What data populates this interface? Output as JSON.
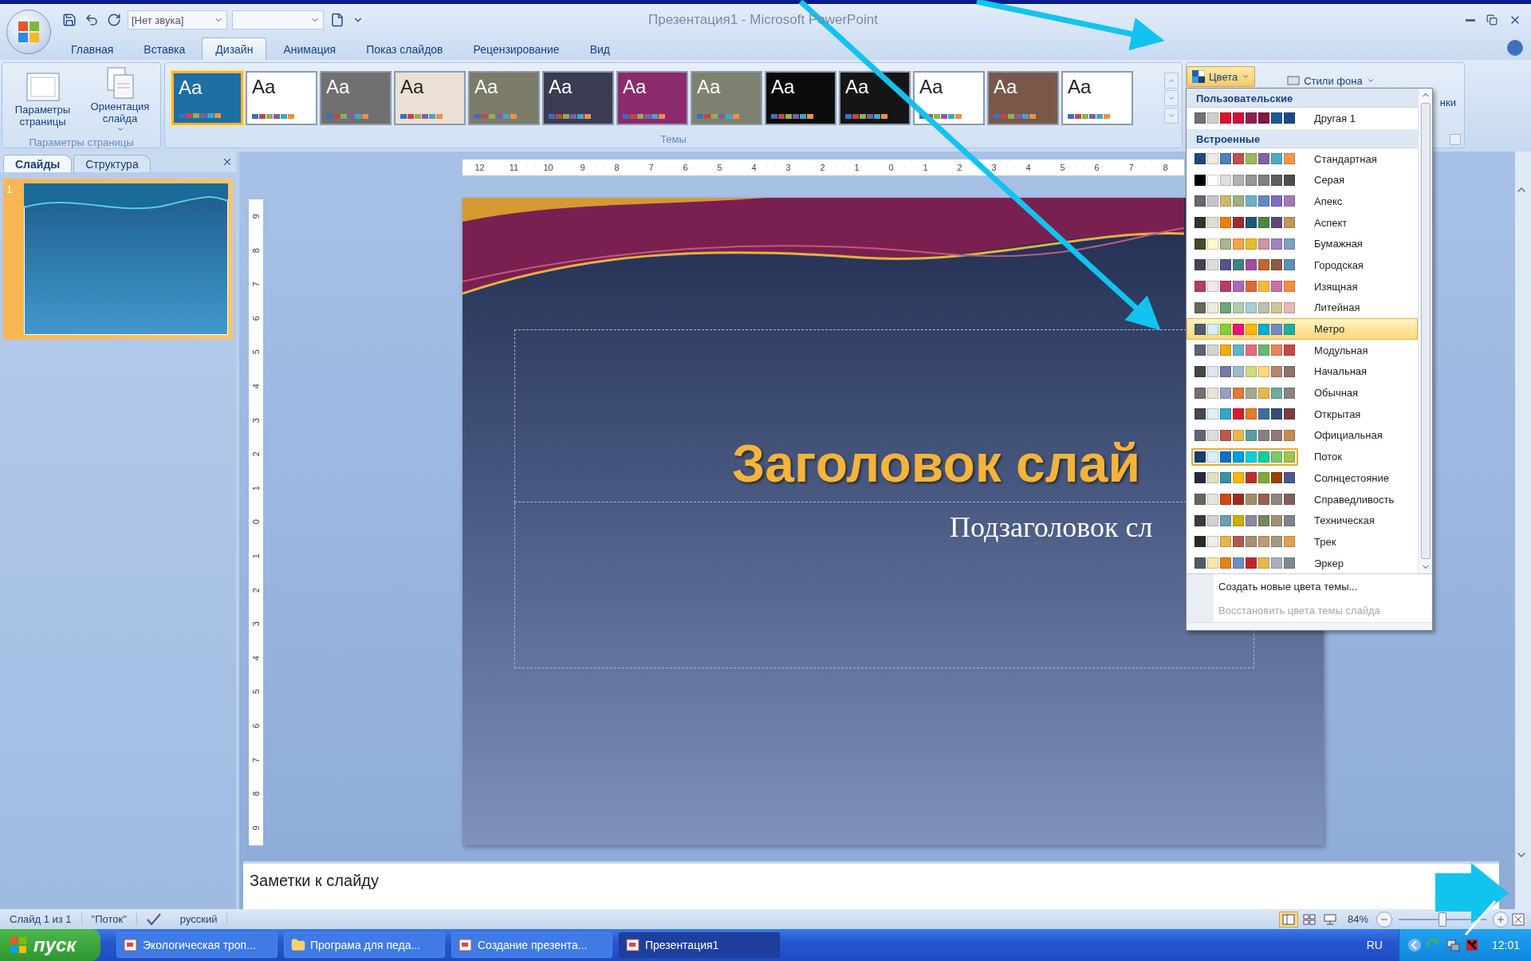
{
  "window": {
    "title": "Презентация1 - Microsoft PowerPoint"
  },
  "quick_access": {
    "sound": "[Нет звука]"
  },
  "tabs": [
    {
      "label": "Главная",
      "selected": false
    },
    {
      "label": "Вставка",
      "selected": false
    },
    {
      "label": "Дизайн",
      "selected": true
    },
    {
      "label": "Анимация",
      "selected": false
    },
    {
      "label": "Показ слайдов",
      "selected": false
    },
    {
      "label": "Рецензирование",
      "selected": false
    },
    {
      "label": "Вид",
      "selected": false
    }
  ],
  "ribbon": {
    "page_group": {
      "title": "Параметры страницы",
      "buttons": [
        {
          "label": "Параметры страницы",
          "kind": "page",
          "dropdown": false
        },
        {
          "label": "Ориентация слайда",
          "kind": "orientation",
          "dropdown": true
        }
      ]
    },
    "themes": {
      "title": "Темы",
      "items": [
        {
          "label": "Aa",
          "color": "#1d6fa5",
          "selected": true
        },
        {
          "label": "Aa",
          "color": "#ffffff",
          "selected": false
        },
        {
          "label": "Aa",
          "color": "#707070",
          "selected": false
        },
        {
          "label": "Aa",
          "color": "#ece0d4",
          "selected": false
        },
        {
          "label": "Aa",
          "color": "#7b7b68",
          "selected": false
        },
        {
          "label": "Aa",
          "color": "#3b3b52",
          "selected": false
        },
        {
          "label": "Aa",
          "color": "#8c2a6e",
          "selected": false
        },
        {
          "label": "Aa",
          "color": "#7e8170",
          "selected": false
        },
        {
          "label": "Aa",
          "color": "#0b0b0b",
          "selected": false
        },
        {
          "label": "Aa",
          "color": "#151515",
          "selected": false
        },
        {
          "label": "Aa",
          "color": "#ffffff",
          "selected": false
        },
        {
          "label": "Aa",
          "color": "#7a5848",
          "selected": false
        },
        {
          "label": "Aa",
          "color": "#ffffff",
          "selected": false
        }
      ]
    },
    "colors_button": {
      "label": "Цвета",
      "pressed": true
    },
    "background_styles": {
      "label": "Стили фона"
    },
    "cut_label": "нки"
  },
  "slides_pane": {
    "tabs": [
      {
        "label": "Слайды",
        "selected": true
      },
      {
        "label": "Структура",
        "selected": false
      }
    ],
    "slides": [
      {
        "number": "1",
        "selected": true
      }
    ]
  },
  "rulers": {
    "horizontal": [
      "12",
      "11",
      "10",
      "9",
      "8",
      "7",
      "6",
      "5",
      "4",
      "3",
      "2",
      "1",
      "0",
      "1",
      "2",
      "3",
      "4",
      "5",
      "6",
      "7",
      "8"
    ],
    "vertical": [
      "9",
      "8",
      "7",
      "6",
      "5",
      "4",
      "3",
      "2",
      "1",
      "0",
      "1",
      "2",
      "3",
      "4",
      "5",
      "6",
      "7",
      "8",
      "9"
    ]
  },
  "slide": {
    "title": "Заголовок слай",
    "subtitle": "Подзаголовок сл"
  },
  "notes": {
    "prompt": "Заметки к слайду"
  },
  "colors_menu": {
    "sections": [
      {
        "title": "Пользовательские",
        "schemes": [
          {
            "name": "Другая 1",
            "swatches": [
              {
                "color": "#707070"
              },
              {
                "color": "#d0d0d0"
              },
              {
                "color": "#e01030"
              },
              {
                "color": "#d01040"
              },
              {
                "color": "#902050"
              },
              {
                "color": "#801848"
              },
              {
                "color": "#1a5a9a"
              },
              {
                "color": "#1a4a8a"
              }
            ],
            "highlighted": false,
            "selected": false
          }
        ]
      },
      {
        "title": "Встроенные",
        "schemes": [
          {
            "name": "Стандартная",
            "swatches": [
              {
                "color": "#1f497d"
              },
              {
                "color": "#eeece1"
              },
              {
                "color": "#4f81bd"
              },
              {
                "color": "#c0504d"
              },
              {
                "color": "#9bbb59"
              },
              {
                "color": "#8064a2"
              },
              {
                "color": "#4bacc6"
              },
              {
                "color": "#f79646"
              }
            ],
            "highlighted": false,
            "selected": false
          },
          {
            "name": "Серая",
            "swatches": [
              {
                "color": "#000000"
              },
              {
                "color": "#ffffff"
              },
              {
                "color": "#dddddd"
              },
              {
                "color": "#b2b2b2"
              },
              {
                "color": "#969696"
              },
              {
                "color": "#808080"
              },
              {
                "color": "#5f5f5f"
              },
              {
                "color": "#4d4d4d"
              }
            ],
            "highlighted": false,
            "selected": false
          },
          {
            "name": "Апекс",
            "swatches": [
              {
                "color": "#69676d"
              },
              {
                "color": "#c9c2d1"
              },
              {
                "color": "#ceb966"
              },
              {
                "color": "#9cb084"
              },
              {
                "color": "#6bb1c9"
              },
              {
                "color": "#6585cf"
              },
              {
                "color": "#7e6bc9"
              },
              {
                "color": "#a379bb"
              }
            ],
            "highlighted": false,
            "selected": false
          },
          {
            "name": "Аспект",
            "swatches": [
              {
                "color": "#323232"
              },
              {
                "color": "#e3ded1"
              },
              {
                "color": "#f07f09"
              },
              {
                "color": "#9f2936"
              },
              {
                "color": "#1b587c"
              },
              {
                "color": "#4e8542"
              },
              {
                "color": "#604878"
              },
              {
                "color": "#c19859"
              }
            ],
            "highlighted": false,
            "selected": false
          },
          {
            "name": "Бумажная",
            "swatches": [
              {
                "color": "#444d26"
              },
              {
                "color": "#fefac9"
              },
              {
                "color": "#a5b592"
              },
              {
                "color": "#f3a447"
              },
              {
                "color": "#e7bc29"
              },
              {
                "color": "#d092a7"
              },
              {
                "color": "#9c85c0"
              },
              {
                "color": "#809ec2"
              }
            ],
            "highlighted": false,
            "selected": false
          },
          {
            "name": "Городская",
            "swatches": [
              {
                "color": "#424456"
              },
              {
                "color": "#dedede"
              },
              {
                "color": "#53548a"
              },
              {
                "color": "#438086"
              },
              {
                "color": "#a04da3"
              },
              {
                "color": "#c4652d"
              },
              {
                "color": "#8b5d3d"
              },
              {
                "color": "#5c92b5"
              }
            ],
            "highlighted": false,
            "selected": false
          },
          {
            "name": "Изящная",
            "swatches": [
              {
                "color": "#b13f5a"
              },
              {
                "color": "#f4e7ed"
              },
              {
                "color": "#b83d68"
              },
              {
                "color": "#ac66bb"
              },
              {
                "color": "#de6c36"
              },
              {
                "color": "#f9b639"
              },
              {
                "color": "#cf6da4"
              },
              {
                "color": "#fa8d3d"
              }
            ],
            "highlighted": false,
            "selected": false
          },
          {
            "name": "Литейная",
            "swatches": [
              {
                "color": "#676a55"
              },
              {
                "color": "#eaebde"
              },
              {
                "color": "#72a376"
              },
              {
                "color": "#b0ccb0"
              },
              {
                "color": "#a8cdd7"
              },
              {
                "color": "#c0beaf"
              },
              {
                "color": "#cec597"
              },
              {
                "color": "#e8b7b7"
              }
            ],
            "highlighted": false,
            "selected": false
          },
          {
            "name": "Метро",
            "swatches": [
              {
                "color": "#4e5b6f"
              },
              {
                "color": "#d6ecff"
              },
              {
                "color": "#7fd13b"
              },
              {
                "color": "#ea157a"
              },
              {
                "color": "#feb80a"
              },
              {
                "color": "#00addc"
              },
              {
                "color": "#738ac8"
              },
              {
                "color": "#1ab39f"
              }
            ],
            "highlighted": true,
            "selected": false
          },
          {
            "name": "Модульная",
            "swatches": [
              {
                "color": "#5a6378"
              },
              {
                "color": "#d4d4d6"
              },
              {
                "color": "#f0ad00"
              },
              {
                "color": "#60b5cc"
              },
              {
                "color": "#e66c7d"
              },
              {
                "color": "#6bb76d"
              },
              {
                "color": "#e88651"
              },
              {
                "color": "#c64847"
              }
            ],
            "highlighted": false,
            "selected": false
          },
          {
            "name": "Начальная",
            "swatches": [
              {
                "color": "#464646"
              },
              {
                "color": "#dee6ef"
              },
              {
                "color": "#727ca3"
              },
              {
                "color": "#9fb8cd"
              },
              {
                "color": "#d2da7a"
              },
              {
                "color": "#fada7a"
              },
              {
                "color": "#b88472"
              },
              {
                "color": "#8e736a"
              }
            ],
            "highlighted": false,
            "selected": false
          },
          {
            "name": "Обычная",
            "swatches": [
              {
                "color": "#756f6f"
              },
              {
                "color": "#eae4d7"
              },
              {
                "color": "#93a3c0"
              },
              {
                "color": "#de7a3a"
              },
              {
                "color": "#a2a98c"
              },
              {
                "color": "#e8b54d"
              },
              {
                "color": "#6fa9a0"
              },
              {
                "color": "#8a8585"
              }
            ],
            "highlighted": false,
            "selected": false
          },
          {
            "name": "Открытая",
            "swatches": [
              {
                "color": "#464653"
              },
              {
                "color": "#e0f0fa"
              },
              {
                "color": "#30a6c9"
              },
              {
                "color": "#dc1c2b"
              },
              {
                "color": "#e57c2a"
              },
              {
                "color": "#3b6ea0"
              },
              {
                "color": "#364e74"
              },
              {
                "color": "#7d3b3b"
              }
            ],
            "highlighted": false,
            "selected": false
          },
          {
            "name": "Официальная",
            "swatches": [
              {
                "color": "#5e6676"
              },
              {
                "color": "#dddddd"
              },
              {
                "color": "#bc5a4e"
              },
              {
                "color": "#e8b54d"
              },
              {
                "color": "#57a0a5"
              },
              {
                "color": "#8a7f7f"
              },
              {
                "color": "#937776"
              },
              {
                "color": "#c78a4f"
              }
            ],
            "highlighted": false,
            "selected": false
          },
          {
            "name": "Поток",
            "swatches": [
              {
                "color": "#17406d"
              },
              {
                "color": "#dbefff"
              },
              {
                "color": "#0f6fc6"
              },
              {
                "color": "#009dd9"
              },
              {
                "color": "#0bd0d9"
              },
              {
                "color": "#10cf9b"
              },
              {
                "color": "#7cca62"
              },
              {
                "color": "#a5c249"
              }
            ],
            "highlighted": false,
            "selected": true
          },
          {
            "name": "Солнцестояние",
            "swatches": [
              {
                "color": "#2a2440"
              },
              {
                "color": "#e3dfc1"
              },
              {
                "color": "#3891a7"
              },
              {
                "color": "#feb80a"
              },
              {
                "color": "#c32d2e"
              },
              {
                "color": "#84aa33"
              },
              {
                "color": "#964305"
              },
              {
                "color": "#475a8d"
              }
            ],
            "highlighted": false,
            "selected": false
          },
          {
            "name": "Справедливость",
            "swatches": [
              {
                "color": "#696464"
              },
              {
                "color": "#e9e5dc"
              },
              {
                "color": "#d34817"
              },
              {
                "color": "#9b2d1f"
              },
              {
                "color": "#a28e6a"
              },
              {
                "color": "#956251"
              },
              {
                "color": "#918485"
              },
              {
                "color": "#855d5d"
              }
            ],
            "highlighted": false,
            "selected": false
          },
          {
            "name": "Техническая",
            "swatches": [
              {
                "color": "#3b3b3b"
              },
              {
                "color": "#d4d2d0"
              },
              {
                "color": "#6ea0b0"
              },
              {
                "color": "#ccaf0a"
              },
              {
                "color": "#8d89a4"
              },
              {
                "color": "#748560"
              },
              {
                "color": "#9e9273"
              },
              {
                "color": "#7e848d"
              }
            ],
            "highlighted": false,
            "selected": false
          },
          {
            "name": "Трек",
            "swatches": [
              {
                "color": "#2a2a2a"
              },
              {
                "color": "#f0eee5"
              },
              {
                "color": "#e8b54d"
              },
              {
                "color": "#b05c4d"
              },
              {
                "color": "#a89070"
              },
              {
                "color": "#c39a72"
              },
              {
                "color": "#a09c80"
              },
              {
                "color": "#e0a050"
              }
            ],
            "highlighted": false,
            "selected": false
          },
          {
            "name": "Эркер",
            "swatches": [
              {
                "color": "#505a6a"
              },
              {
                "color": "#fbe8a8"
              },
              {
                "color": "#e48312"
              },
              {
                "color": "#6b8ec5"
              },
              {
                "color": "#c3252d"
              },
              {
                "color": "#e8b54d"
              },
              {
                "color": "#a8b0c0"
              },
              {
                "color": "#7f8a90"
              }
            ],
            "highlighted": false,
            "selected": false
          }
        ]
      }
    ],
    "actions": [
      {
        "label": "Создать новые цвета темы...",
        "disabled": false
      },
      {
        "label": "Восстановить цвета темы слайда",
        "disabled": true
      }
    ]
  },
  "status_bar": {
    "slide": "Слайд 1 из 1",
    "theme": "\"Поток\"",
    "language": "русский",
    "views": [
      {
        "kind": "normal",
        "selected": true
      },
      {
        "kind": "sorter",
        "selected": false
      },
      {
        "kind": "show",
        "selected": false
      }
    ],
    "zoom": "84%",
    "zoom_slider": {
      "level": 0.5
    }
  },
  "taskbar": {
    "start": "пуск",
    "items": [
      {
        "label": "Экологическая троп...",
        "kind": "presentation",
        "selected": false
      },
      {
        "label": "Програма для педа...",
        "kind": "folder",
        "selected": false
      },
      {
        "label": "Создание презента...",
        "kind": "presentation",
        "selected": false
      },
      {
        "label": "Презентация1",
        "kind": "presentation",
        "selected": true
      }
    ],
    "language": "RU",
    "time": "12:01"
  }
}
